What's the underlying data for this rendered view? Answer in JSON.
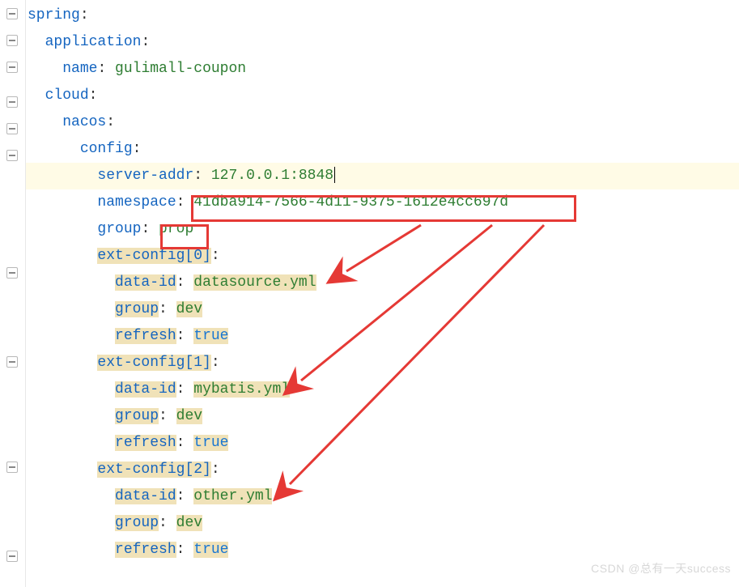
{
  "yaml": {
    "spring": "spring",
    "application": "application",
    "name_key": "name",
    "name_val": "gulimall-coupon",
    "cloud": "cloud",
    "nacos": "nacos",
    "config": "config",
    "server_addr_key": "server-addr",
    "server_addr_val": "127.0.0.1:8848",
    "namespace_key": "namespace",
    "namespace_val": "41dba914-7566-4d11-9375-1612e4cc697d",
    "group_key": "group",
    "group_val": "prop",
    "ext0": "ext-config[0]",
    "ext1": "ext-config[1]",
    "ext2": "ext-config[2]",
    "data_id_key": "data-id",
    "ds_yml": "datasource.yml",
    "mybatis_yml": "mybatis.yml",
    "other_yml": "other.yml",
    "dev": "dev",
    "refresh_key": "refresh",
    "true": "true"
  },
  "watermark": "CSDN @总有一天success",
  "colors": {
    "highlight_red": "#e53935",
    "warn_bg": "#f0e2b8",
    "line_hl": "#fffbe6",
    "key": "#1565c0",
    "val": "#2e7d32"
  }
}
